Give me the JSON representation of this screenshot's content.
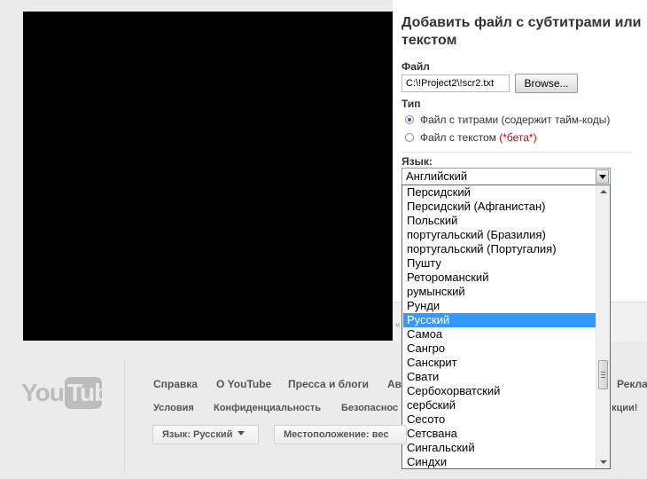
{
  "dialog": {
    "title": "Добавить файл с субтитрами или текстом",
    "file_label": "Файл",
    "file_value": "C:\\!Project2\\!scr2.txt",
    "browse_label": "Browse...",
    "type_label": "Тип",
    "type_options": [
      {
        "label": "Файл с титрами (содержит тайм-коды)",
        "selected": true
      },
      {
        "label": "Файл с текстом",
        "beta": "(*бета*)",
        "selected": false
      }
    ],
    "language_label": "Язык:",
    "language_selected": "Английский",
    "language_options": [
      "Персидский",
      "Персидский (Афганистан)",
      "Польский",
      "португальский (Бразилия)",
      "португальский (Португалия)",
      "Пушту",
      "Ретороманский",
      "румынский",
      "Рунди",
      "Русский",
      "Самоа",
      "Сангро",
      "Санскрит",
      "Свати",
      "Сербохорватский",
      "сербский",
      "Сесото",
      "Сетсвана",
      "Сингальский",
      "Синдхи"
    ],
    "highlighted_option": "Русский"
  },
  "footer": {
    "logo": {
      "you": "You",
      "tube": "Tube"
    },
    "links_row1": [
      "Справка",
      "О YouTube",
      "Пресса и блоги",
      "Ав",
      "Рекла"
    ],
    "links_row2": [
      "Условия",
      "Конфиденциальность",
      "Безопаснос",
      "кции!"
    ],
    "language_button": "Язык: Русский",
    "location_button": "Местоположение: вес"
  },
  "colors": {
    "highlight": "#3399ff",
    "beta": "#cc0000",
    "background": "#ebebeb"
  }
}
